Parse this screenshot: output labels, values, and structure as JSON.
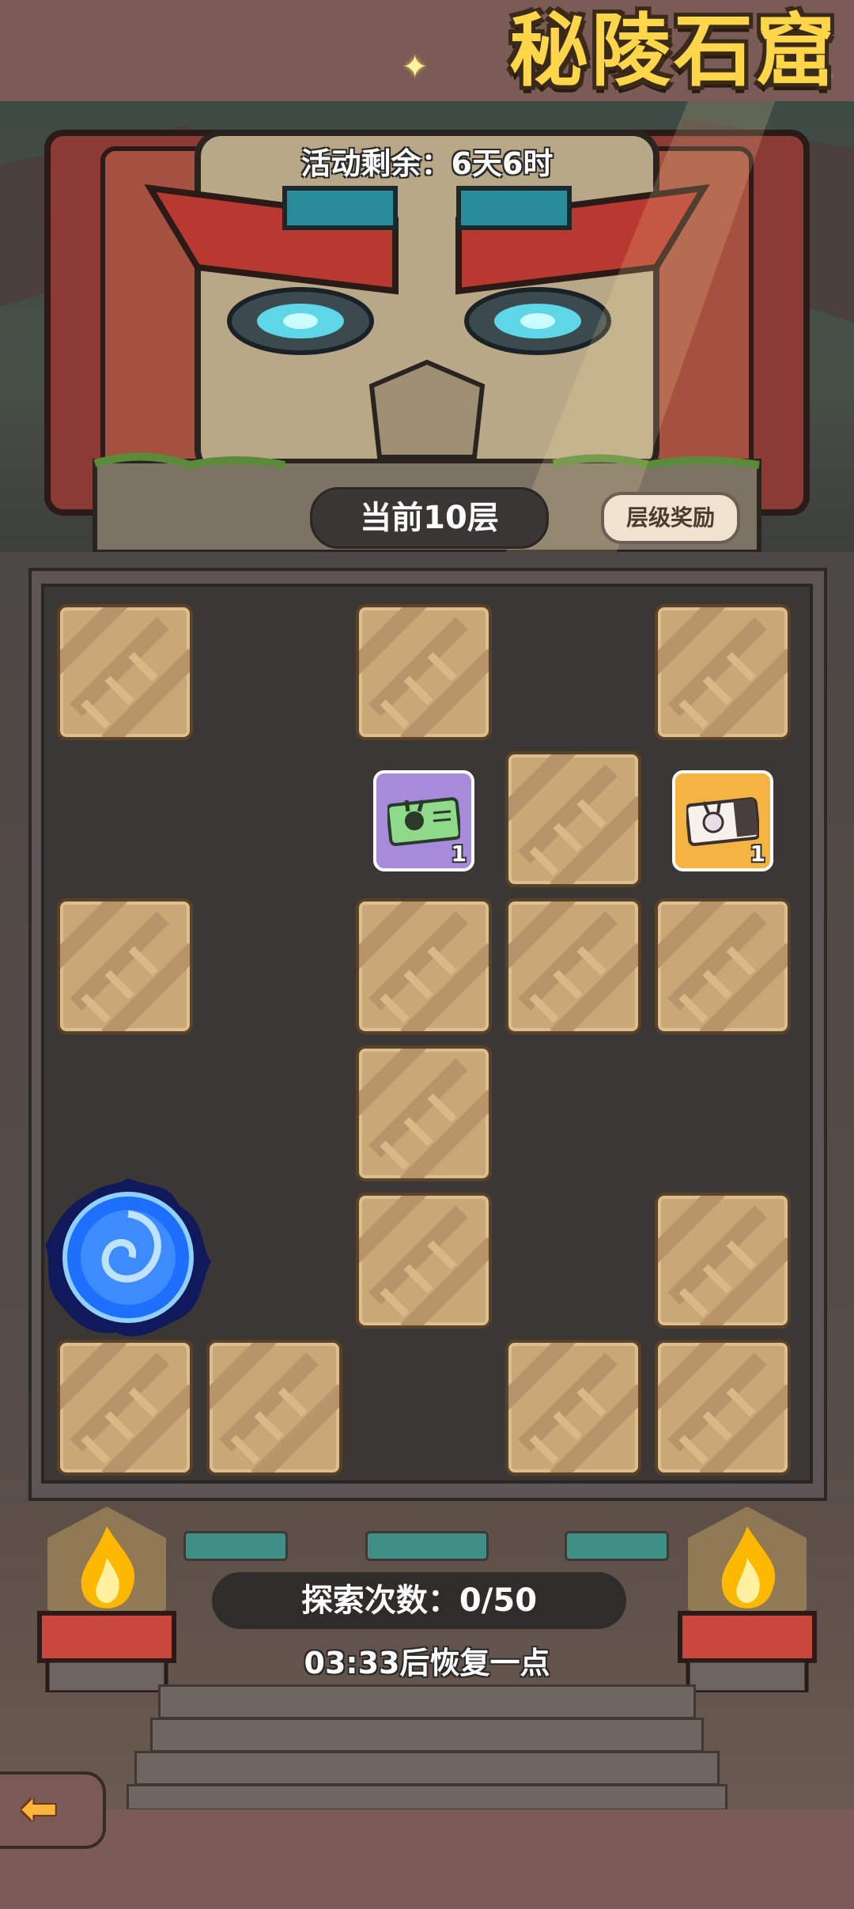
{
  "header": {
    "title": "秘陵石窟"
  },
  "event": {
    "time_remaining": "活动剩余：6天6时"
  },
  "floor": {
    "current": "当前10层",
    "reward_button": "层级奖励"
  },
  "board": {
    "items": [
      {
        "name": "green-rabbit-ticket",
        "count": "1"
      },
      {
        "name": "rabbit-ticket-orange",
        "count": "1"
      }
    ]
  },
  "explore": {
    "counter": "探索次数：0/50",
    "recover_text": "03:33后恢复一点"
  },
  "colors": {
    "title": "#ffd649",
    "tile": "#c9a776",
    "board": "#3b3735",
    "portal": "#1f6fff"
  },
  "icons": {
    "back": "back-arrow-icon",
    "portal": "portal-icon",
    "torch": "torch-fire-icon"
  }
}
